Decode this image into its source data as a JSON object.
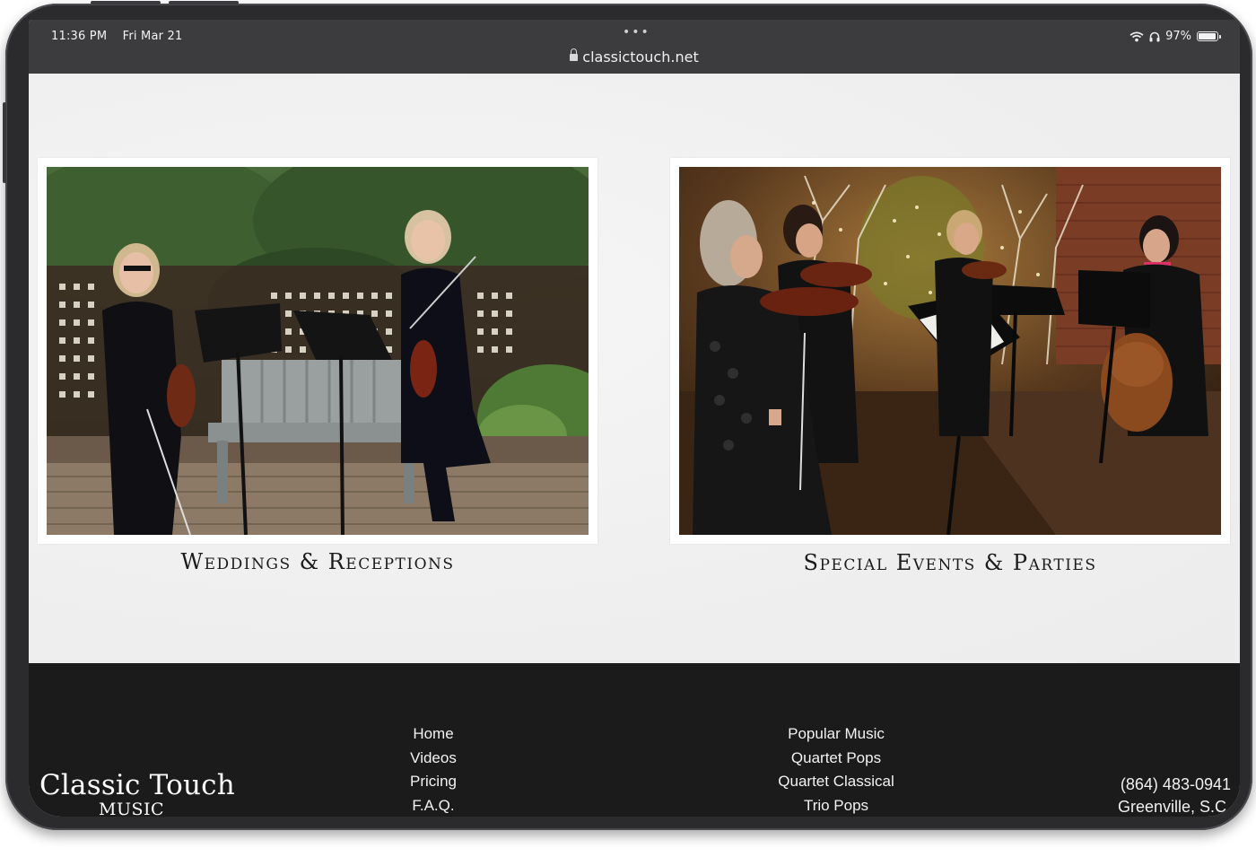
{
  "status_bar": {
    "time": "11:36 PM",
    "date": "Fri Mar 21",
    "battery": "97%"
  },
  "browser": {
    "url": "classictouch.net",
    "dots": "•••"
  },
  "cards": [
    {
      "caption": "Weddings & Receptions"
    },
    {
      "caption": "Special Events & Parties"
    }
  ],
  "footer": {
    "logo_main": "Classic Touch",
    "logo_sub": "MUSIC",
    "nav_col1": [
      "Home",
      "Videos",
      "Pricing",
      "F.A.Q."
    ],
    "nav_col2": [
      "Popular Music",
      "Quartet Pops",
      "Quartet Classical",
      "Trio Pops"
    ],
    "phone": "(864) 483-0941",
    "location": "Greenville, S.C."
  },
  "colors": {
    "footer_bg": "#1b1b1b",
    "chrome_bg": "#3c3c3f",
    "page_bg": "#f1f1f1"
  },
  "icons": [
    "lock-icon",
    "wifi-icon",
    "headphones-icon",
    "battery-icon"
  ]
}
